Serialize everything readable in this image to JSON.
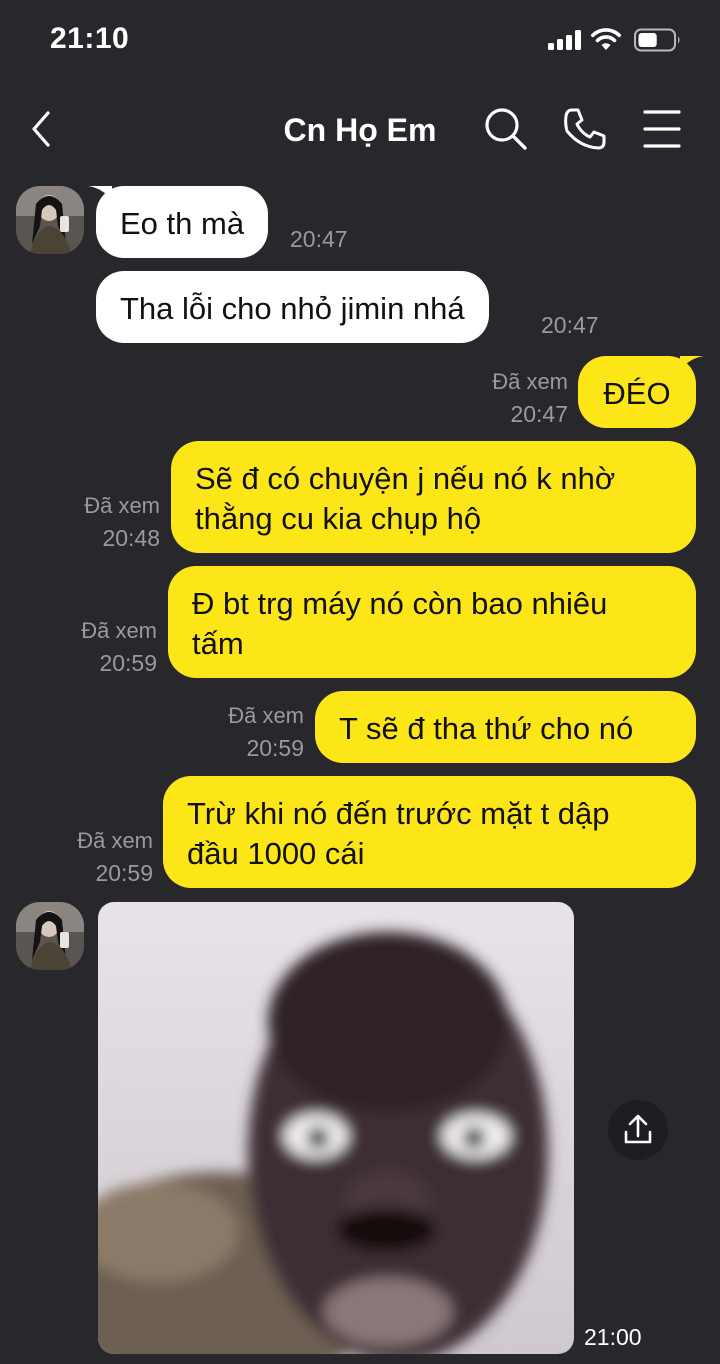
{
  "status_bar": {
    "time": "21:10",
    "battery_level": 0.55
  },
  "header": {
    "title": "Cn Họ Em"
  },
  "icons": {
    "back": "chevron-left-icon",
    "search": "search-icon",
    "call": "phone-icon",
    "menu": "hamburger-menu-icon",
    "share": "share-upload-icon"
  },
  "colors": {
    "background": "#28272c",
    "incoming_bubble": "#ffffff",
    "outgoing_bubble": "#fde618",
    "meta_text": "#9a999f"
  },
  "messages": [
    {
      "direction": "incoming",
      "text": "Eo th mà",
      "time": "20:47"
    },
    {
      "direction": "incoming",
      "text": "Tha lỗi cho nhỏ jimin nhá",
      "time": "20:47"
    },
    {
      "direction": "outgoing",
      "text": "ĐÉO",
      "seen": "Đã xem",
      "time": "20:47"
    },
    {
      "direction": "outgoing",
      "text": "Sẽ đ có chuyện j nếu nó k nhờ thằng cu kia chụp hộ",
      "line1": "Sẽ đ có chuyện j nếu nó k nhờ",
      "line2": "thằng cu kia chụp hộ",
      "seen": "Đã xem",
      "time": "20:48"
    },
    {
      "direction": "outgoing",
      "text": "Đ bt trg máy nó còn bao nhiêu tấm",
      "line1": "Đ bt trg máy nó còn bao nhiêu",
      "line2": "tấm",
      "seen": "Đã xem",
      "time": "20:59"
    },
    {
      "direction": "outgoing",
      "text": "T sẽ đ tha thứ cho nó",
      "seen": "Đã xem",
      "time": "20:59"
    },
    {
      "direction": "outgoing",
      "text": "Trừ khi nó đến trước mặt t dập đầu 1000 cái",
      "line1": "Trừ khi nó đến trước mặt t dập",
      "line2": "đầu 1000 cái",
      "seen": "Đã xem",
      "time": "20:59"
    },
    {
      "direction": "incoming",
      "type": "photo",
      "time": "21:00"
    }
  ]
}
